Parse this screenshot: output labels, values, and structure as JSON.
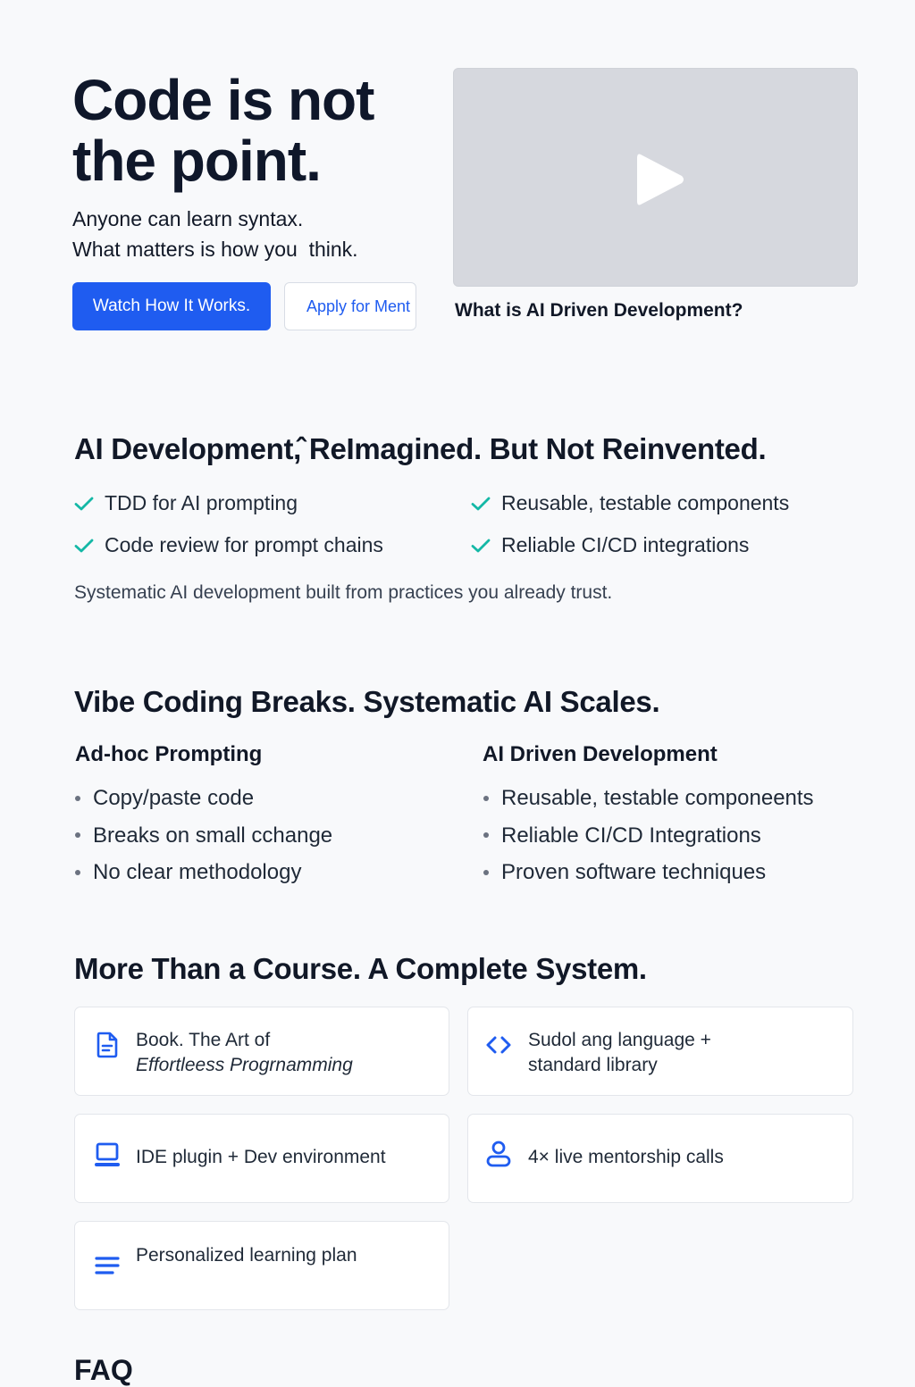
{
  "hero": {
    "title": "Code is not the point.",
    "subtitle_line1": "Anyone can learn syntax.",
    "subtitle_line2": "What matters is how you  think.",
    "primary_button": "Watch How It Works.",
    "secondary_button": "Apply for Ment",
    "video_caption": "What is AI Driven Development?"
  },
  "ai_section": {
    "heading": "AI Development,̂ ReImagined. But Not Reinvented.",
    "checks": [
      "TDD for AI prompting",
      "Reusable, testable components",
      "Code review for prompt chains",
      "Reliable CI/CD integrations"
    ],
    "tagline": "Systematic AI development built from practices you already trust."
  },
  "vibe_section": {
    "heading": "Vibe Coding Breaks. Systematic AI Scales.",
    "left": {
      "title": "Ad-hoc Prompting",
      "items": [
        "Copy/paste code",
        "Breaks on small cchange",
        "No clear methodology"
      ]
    },
    "right": {
      "title": "AI Driven Development",
      "items": [
        "Reusable, testable componeents",
        "Reliable CI/CD Integrations",
        "Proven software techniques"
      ]
    }
  },
  "system_section": {
    "heading": "More Than a Course. A Complete System.",
    "cards": [
      {
        "icon": "document-icon",
        "line1": "Book. The Art of",
        "line2": "Effortleess Progrnamming"
      },
      {
        "icon": "code-icon",
        "line1": "Sudol ang language +",
        "line2": "standard library"
      },
      {
        "icon": "laptop-icon",
        "line1": "IDE plugin + Dev environment",
        "line2": ""
      },
      {
        "icon": "person-icon",
        "line1": "4× live mentorship calls",
        "line2": ""
      },
      {
        "icon": "list-icon",
        "line1": "Personalized learning plan",
        "line2": ""
      }
    ]
  },
  "faq": {
    "heading": "FAQ"
  },
  "colors": {
    "accent": "#1f5cf0",
    "check": "#14b8a6",
    "background": "#f8f9fb"
  }
}
